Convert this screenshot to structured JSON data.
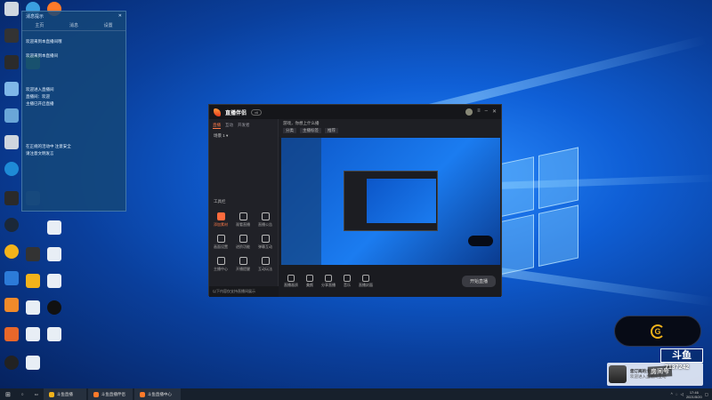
{
  "chat": {
    "title": "消息提示",
    "tabs": [
      "主页",
      "消息",
      "设置"
    ],
    "messages": [
      "欢迎来到本直播间哦",
      "欢迎来到本直播间",
      "欢迎进入直播间",
      "直播间：欢迎",
      "主播已开启直播",
      "在正规的活动中 注意安全",
      "请注意文明发言"
    ]
  },
  "app": {
    "brand": "直播伴侣",
    "version": "v6",
    "left_tabs": [
      "直播",
      "互动",
      "开发者"
    ],
    "scene": "场景 1",
    "tools_label": "工具栏",
    "tools": [
      "添加素材",
      "观看直播",
      "直播公告",
      "画面设置",
      "进阶功能",
      "弹幕互动",
      "主播中心",
      "开播提醒",
      "互动玩法"
    ],
    "title_text": "游戏，你想上什么播",
    "tags": [
      "分类",
      "主播标签",
      "推荐"
    ],
    "bottom_buttons": [
      "直播画质",
      "美颜",
      "分享直播",
      "音乐",
      "直播封面"
    ],
    "go_live": "开始直播",
    "footer_note": "以下内容仅支持直播间展示"
  },
  "overlay": {
    "platform": "斗鱼",
    "room_id": "7137242",
    "badge": "房间号",
    "notif_title": "您订阅的主播开播了",
    "notif_sub": "欢迎进入直播间互动"
  },
  "taskbar": {
    "items": [
      "斗鱼直播",
      "斗鱼直播伴侣",
      "斗鱼直播中心"
    ],
    "time": "17:46",
    "date": "2021/5/20"
  }
}
